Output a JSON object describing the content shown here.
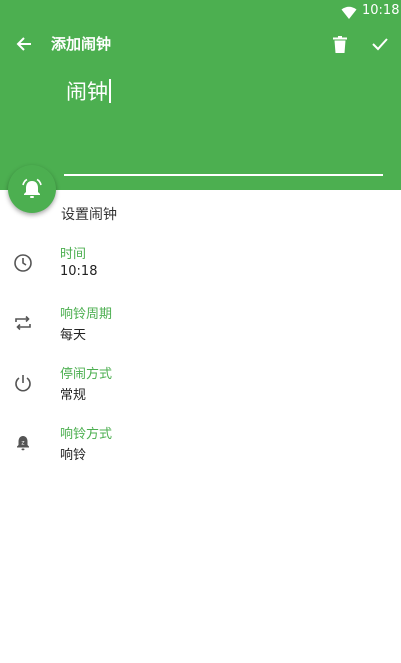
{
  "status_bar": {
    "time": "10:18"
  },
  "toolbar": {
    "title": "添加闹钟"
  },
  "alarm_name_input": {
    "value": "闹钟"
  },
  "section": {
    "title": "设置闹钟"
  },
  "settings": [
    {
      "label": "时间",
      "value": "10:18",
      "icon": "clock-icon"
    },
    {
      "label": "响铃周期",
      "value": "每天",
      "icon": "repeat-icon"
    },
    {
      "label": "停闹方式",
      "value": "常规",
      "icon": "power-icon"
    },
    {
      "label": "响铃方式",
      "value": "响铃",
      "icon": "bell-icon"
    }
  ],
  "colors": {
    "accent": "#4caf50",
    "label": "#4caf50",
    "text": "#222222"
  }
}
